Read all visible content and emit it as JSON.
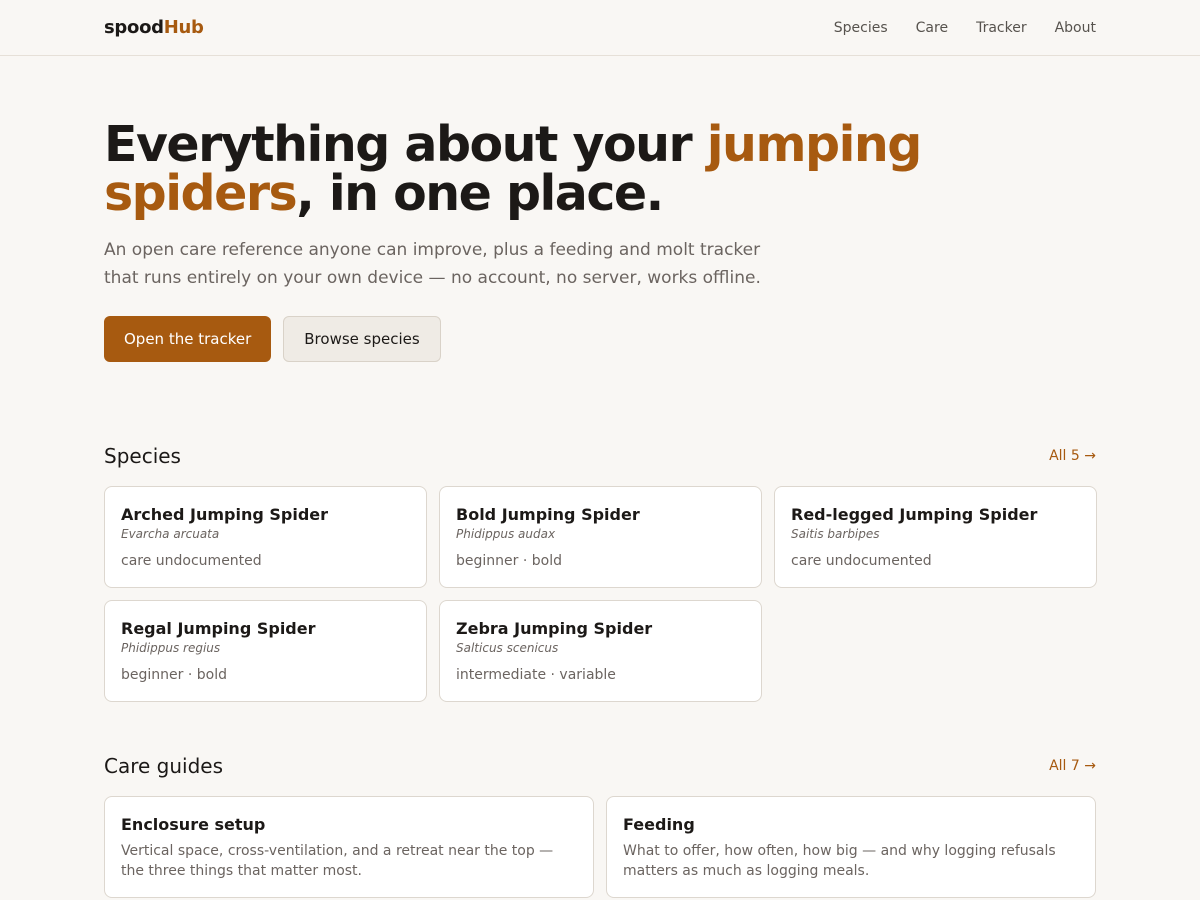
{
  "brand": {
    "part1": "spood",
    "part2": "Hub"
  },
  "nav": [
    "Species",
    "Care",
    "Tracker",
    "About"
  ],
  "hero": {
    "title_before": "Everything about your ",
    "title_accent": "jumping spiders",
    "title_after": ", in one place.",
    "subtitle": "An open care reference anyone can improve, plus a feeding and molt tracker that runs entirely on your own device — no account, no server, works offline.",
    "primary_button": "Open the tracker",
    "secondary_button": "Browse species"
  },
  "species": {
    "heading": "Species",
    "all_link": "All 5 →",
    "items": [
      {
        "name": "Arched Jumping Spider",
        "scientific": "Evarcha arcuata",
        "tags": "care undocumented"
      },
      {
        "name": "Bold Jumping Spider",
        "scientific": "Phidippus audax",
        "tags": "beginner · bold"
      },
      {
        "name": "Red-legged Jumping Spider",
        "scientific": "Saitis barbipes",
        "tags": "care undocumented"
      },
      {
        "name": "Regal Jumping Spider",
        "scientific": "Phidippus regius",
        "tags": "beginner · bold"
      },
      {
        "name": "Zebra Jumping Spider",
        "scientific": "Salticus scenicus",
        "tags": "intermediate · variable"
      }
    ]
  },
  "care": {
    "heading": "Care guides",
    "all_link": "All 7 →",
    "items": [
      {
        "title": "Enclosure setup",
        "desc": "Vertical space, cross-ventilation, and a retreat near the top — the three things that matter most."
      },
      {
        "title": "Feeding",
        "desc": "What to offer, how often, how big — and why logging refusals matters as much as logging meals."
      }
    ]
  },
  "colors": {
    "accent": "#a75a10",
    "background": "#f9f7f4",
    "text": "#1c1917",
    "muted": "#6b6460"
  }
}
